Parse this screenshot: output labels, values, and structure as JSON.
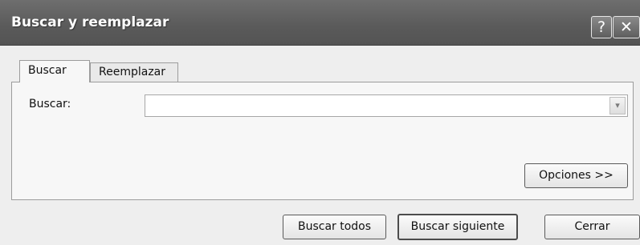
{
  "window": {
    "title": "Buscar y reemplazar",
    "help_glyph": "?",
    "close_glyph": "✕"
  },
  "tabs": [
    {
      "label": "Buscar",
      "active": true
    },
    {
      "label": "Reemplazar",
      "active": false
    }
  ],
  "find": {
    "label": "Buscar:",
    "value": "",
    "dropdown_glyph": "▾"
  },
  "buttons": {
    "options": "Opciones >>",
    "find_all": "Buscar todos",
    "find_next": "Buscar siguiente",
    "close": "Cerrar"
  }
}
